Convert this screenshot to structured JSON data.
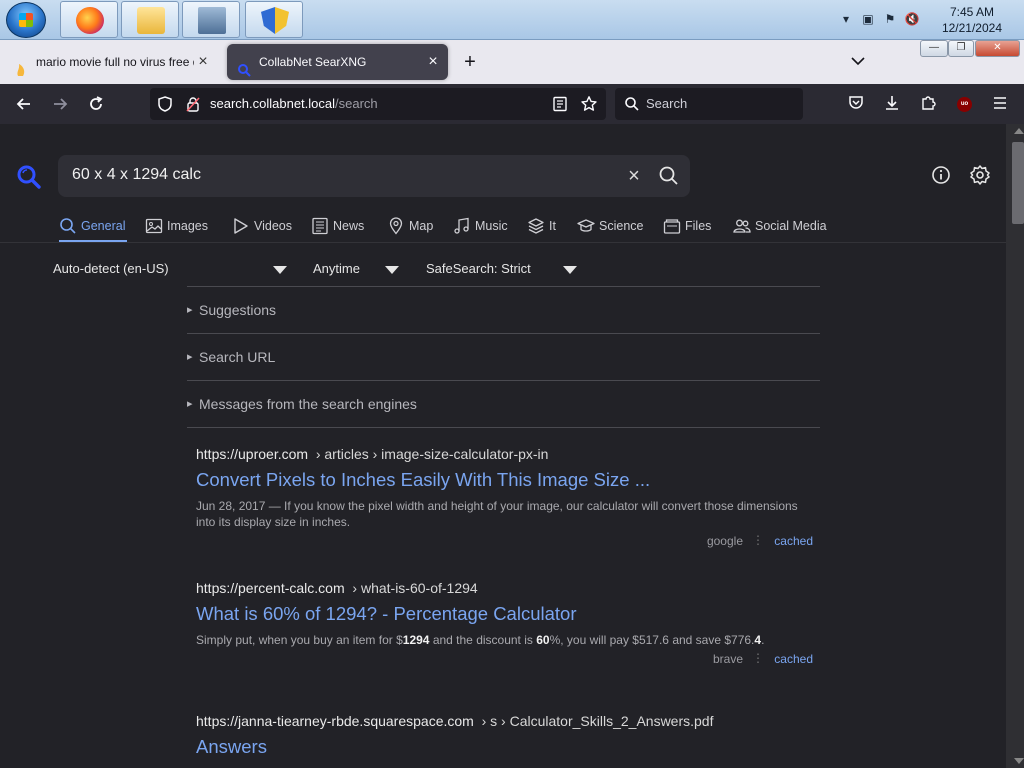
{
  "taskbar": {
    "buttons": [
      "start-orb",
      "firefox",
      "file-explorer",
      "network-pc",
      "security-shield"
    ],
    "clock": {
      "time": "7:45 AM",
      "date": "12/21/2024"
    }
  },
  "tabs": [
    {
      "title": "mario movie full no virus free d",
      "active": false
    },
    {
      "title": "CollabNet SearXNG",
      "active": true
    }
  ],
  "urlbar": {
    "host": "search.collabnet.local",
    "path": "/search"
  },
  "searchbar": {
    "placeholder": "Search"
  },
  "ublock": {
    "badge": "uo"
  },
  "search": {
    "query": "60 x 4 x 1294 calc"
  },
  "categories": [
    {
      "label": "General",
      "icon": "search-icon",
      "active": true
    },
    {
      "label": "Images",
      "icon": "image-icon"
    },
    {
      "label": "Videos",
      "icon": "play-icon"
    },
    {
      "label": "News",
      "icon": "news-icon"
    },
    {
      "label": "Map",
      "icon": "map-pin-icon"
    },
    {
      "label": "Music",
      "icon": "music-icon"
    },
    {
      "label": "It",
      "icon": "layers-icon"
    },
    {
      "label": "Science",
      "icon": "graduation-icon"
    },
    {
      "label": "Files",
      "icon": "files-icon"
    },
    {
      "label": "Social Media",
      "icon": "users-icon"
    }
  ],
  "filters": {
    "language": "Auto-detect (en-US)",
    "time": "Anytime",
    "safesearch": "SafeSearch: Strict"
  },
  "folds": [
    "Suggestions",
    "Search URL",
    "Messages from the search engines"
  ],
  "results": [
    {
      "domain": "https://uproer.com",
      "crumbs": "› articles › image-size-calculator-px-in",
      "title": "Convert Pixels to Inches Easily With This Image Size ...",
      "snippet": "Jun 28, 2017 — If you know the pixel width and height of your image, our calculator will convert those dimensions into its display size in inches.",
      "engine": "google",
      "cached": "cached"
    },
    {
      "domain": "https://percent-calc.com",
      "crumbs": "› what-is-60-of-1294",
      "title": "What is 60% of 1294? - Percentage Calculator",
      "snippet_parts": [
        "Simply put, when you buy an item for $",
        "1294",
        " and the discount is ",
        "60",
        "%, you will pay $517.6 and save $776.",
        "4",
        "."
      ],
      "engine": "brave",
      "cached": "cached"
    },
    {
      "domain": "https://janna-tiearney-rbde.squarespace.com",
      "crumbs": "› s › Calculator_Skills_2_Answers.pdf",
      "title": "Answers"
    }
  ],
  "colors": {
    "accent": "#7aa5f0",
    "page_bg": "#222227",
    "toolbar_bg": "#2b2a33",
    "tab_active": "#42414d"
  }
}
